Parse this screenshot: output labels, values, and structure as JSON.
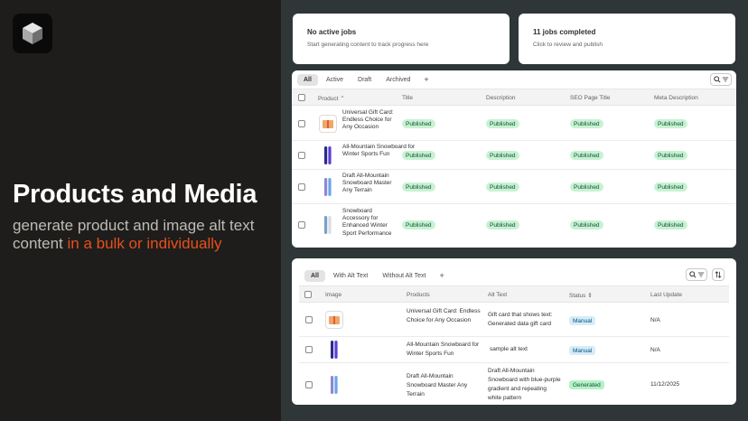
{
  "promo": {
    "title": "Products and Media",
    "subtitle_plain": "generate product and image alt text content ",
    "subtitle_accent": "in a bulk or individually"
  },
  "jobs": {
    "active": {
      "title": "No active jobs",
      "subtitle": "Start generating content to track progress here"
    },
    "completed": {
      "title": "11 jobs completed",
      "subtitle": "Click to review and publish"
    }
  },
  "products_table": {
    "tabs": [
      "All",
      "Active",
      "Draft",
      "Archived"
    ],
    "plus": "+",
    "columns": {
      "product": "Product",
      "sort_icon": "⌃",
      "title": "Title",
      "description": "Description",
      "seo": "SEO Page Title",
      "meta": "Meta Description"
    },
    "rows": [
      {
        "name": "Universal Gift Card: Endless Choice for Any Occasion",
        "title": "Published",
        "description": "Published",
        "seo": "Published",
        "meta": "Published"
      },
      {
        "name": "All-Mountain Snowboard for Winter Sports Fun",
        "title": "Published",
        "description": "Published",
        "seo": "Published",
        "meta": "Published"
      },
      {
        "name": "Draft All-Mountain Snowboard Master Any Terrain",
        "title": "Published",
        "description": "Published",
        "seo": "Published",
        "meta": "Published"
      },
      {
        "name": "Snowboard Accessory for Enhanced Winter Sport Performance",
        "title": "Published",
        "description": "Published",
        "seo": "Published",
        "meta": "Published"
      }
    ]
  },
  "media_table": {
    "tabs": [
      "All",
      "With Alt Text",
      "Without Alt Text"
    ],
    "plus": "+",
    "columns": {
      "image": "Image",
      "products": "Products",
      "alt": "Alt Text",
      "status": "Status",
      "updated": "Last Update"
    },
    "rows": [
      {
        "product": "Universal Gift Card: Endless Choice for Any Occasion",
        "alt": "Gift card that shows text: Generated data gift card",
        "status": "Manual",
        "updated": "N/A"
      },
      {
        "product": "All-Mountain Snowboard for Winter Sports Fun",
        "alt": "sample alt text",
        "status": "Manual",
        "updated": "N/A"
      },
      {
        "product": "Draft All-Mountain Snowboard Master Any Terrain",
        "alt": "Draft All-Mountain Snowboard with blue-purple gradient and repeating white pattern",
        "status": "Generated",
        "updated": "11/12/2025"
      }
    ]
  }
}
